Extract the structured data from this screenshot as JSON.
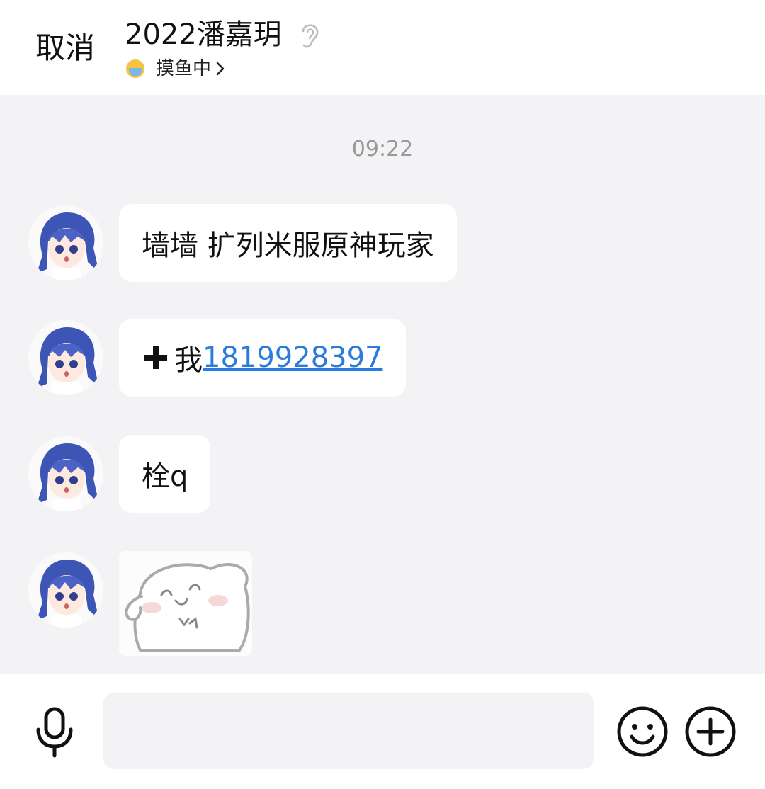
{
  "header": {
    "cancel_label": "取消",
    "title": "2022潘嘉玥",
    "status_text": "摸鱼中"
  },
  "chat": {
    "timestamp": "09:22",
    "messages": [
      {
        "type": "text",
        "text": "墙墙 扩列米服原神玩家"
      },
      {
        "type": "text",
        "prefix_icon": "plus-icon",
        "prefix": "我",
        "link": "1819928397"
      },
      {
        "type": "text",
        "text": "栓q"
      },
      {
        "type": "sticker",
        "icon": "cartoon-sticker"
      }
    ]
  },
  "input_bar": {
    "placeholder": ""
  },
  "colors": {
    "link": "#2a7bdc",
    "timestamp": "#999999",
    "chat_background": "#f3f2f5"
  }
}
